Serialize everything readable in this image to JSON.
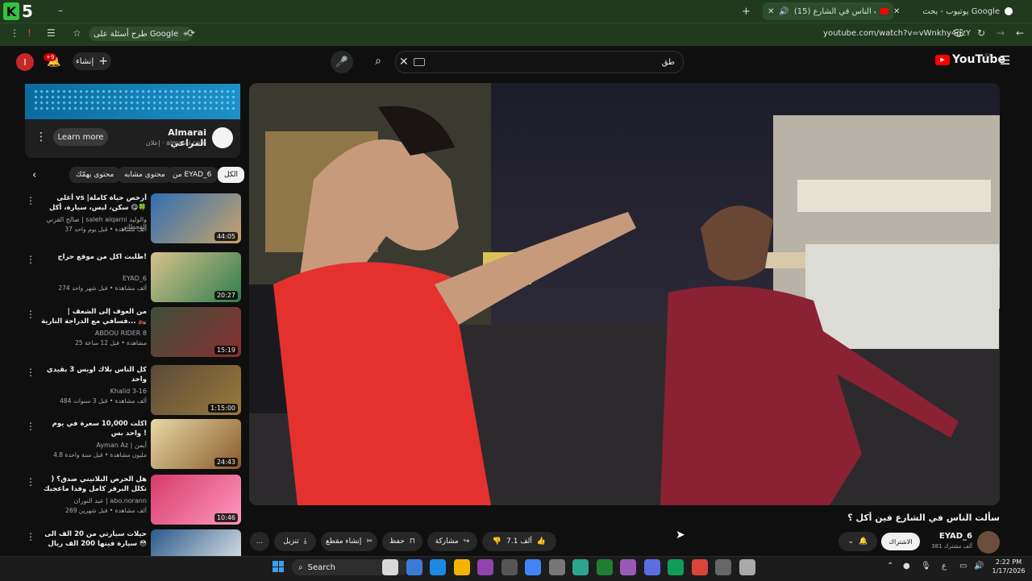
{
  "browser": {
    "logo_text": "5",
    "tabs": [
      {
        "label": "(15) سألت الناس في الشارع",
        "active": true
      },
      {
        "label": "يوتيوب - بحث Google",
        "active": false
      }
    ],
    "google_pill": "طرح أسئلة على Google",
    "url": "youtube.com/watch?v=vWnkhy4gzY"
  },
  "header": {
    "avatar_letter": "I",
    "bell_badge": "+9",
    "create_label": "إنشاء",
    "search_value": "طق",
    "logo_text": "YouTube",
    "region": "SA"
  },
  "ad": {
    "learn_more": "Learn more",
    "title": "Almarai المراعي",
    "subtitle": "إعلان · almarai.com",
    "logo_text": "المراعي"
  },
  "chips": [
    "الكل",
    "من EYAD_6",
    "محتوى مشابه",
    "محتوى يهمّك"
  ],
  "recommendations": [
    {
      "title": "أغلى vs أرخص حياة كاملة| سكن، لبس، سيارة، أكل 😋🍀",
      "channel": "صالح القرني | saleh alqarni والوليد القحطاني",
      "meta": "37 ألف مشاهدة • قبل يوم واحد",
      "duration": "44:05",
      "color1": "#2f6fb3",
      "color2": "#c9a46a"
    },
    {
      "title": "طلبت اكل من موقع حراج!",
      "channel": "EYAD_6",
      "meta": "274 ألف مشاهدة • قبل شهر واحد",
      "duration": "20:27",
      "color1": "#d8c28a",
      "color2": "#2e7d4f"
    },
    {
      "title": "من العوف إلى الشعف | ...فسافي مع الدراجة النارية 🏍️",
      "channel": "ABDOU RIDER 8",
      "meta": "25 مشاهدة • قبل 12 ساعة",
      "duration": "15:19",
      "color1": "#3d4f3a",
      "color2": "#8a3030"
    },
    {
      "title": "كل الناس بلاك اوبس 3 بقيدي واحد",
      "channel": "Khalid 3-16",
      "meta": "484 ألف مشاهدة • قبل 3 سنوات",
      "duration": "1:15:00",
      "color1": "#5a4a3a",
      "color2": "#9a7a3a"
    },
    {
      "title": "اكلت 10,000 سعرة في يوم واحد بس !",
      "channel": "Ayman Az | أيمن",
      "meta": "4.8 مليون مشاهدة • قبل سنة واحدة",
      "duration": "24:43",
      "color1": "#e8d9a8",
      "color2": "#8a5a2a"
    },
    {
      "title": "هل الحرص البلاتيني صدق؟ ( تكلل البرقر كامل وفدا ماعجبك ترجع فلوسك!!؟)",
      "channel": "عبد النوران | abo.norann",
      "meta": "269 ألف مشاهدة • قبل شهرين",
      "duration": "10:46",
      "color1": "#d63a6a",
      "color2": "#ff9ac0"
    },
    {
      "title": "حيلات سيارتي من 20 الف الى سيارة فيتها 200 الف ريال 😳",
      "channel": "",
      "meta": "",
      "duration": "",
      "color1": "#2a5a8a",
      "color2": "#f2f2f2"
    }
  ],
  "video": {
    "title": "سألت الناس في الشارع فين أكل ؟",
    "channel_name": "EYAD_6",
    "channel_subs": "381 ألف مشترك",
    "subscribe_label": "الاشتراك",
    "like_count": "7.1 ألف",
    "share_label": "مشاركة",
    "save_label": "حفظ",
    "clip_label": "إنشاء مقطع",
    "download_label": "تنزيل",
    "more_label": "..."
  },
  "taskbar": {
    "search_label": "Search",
    "time": "2:22 PM",
    "date": "1/17/2026"
  }
}
